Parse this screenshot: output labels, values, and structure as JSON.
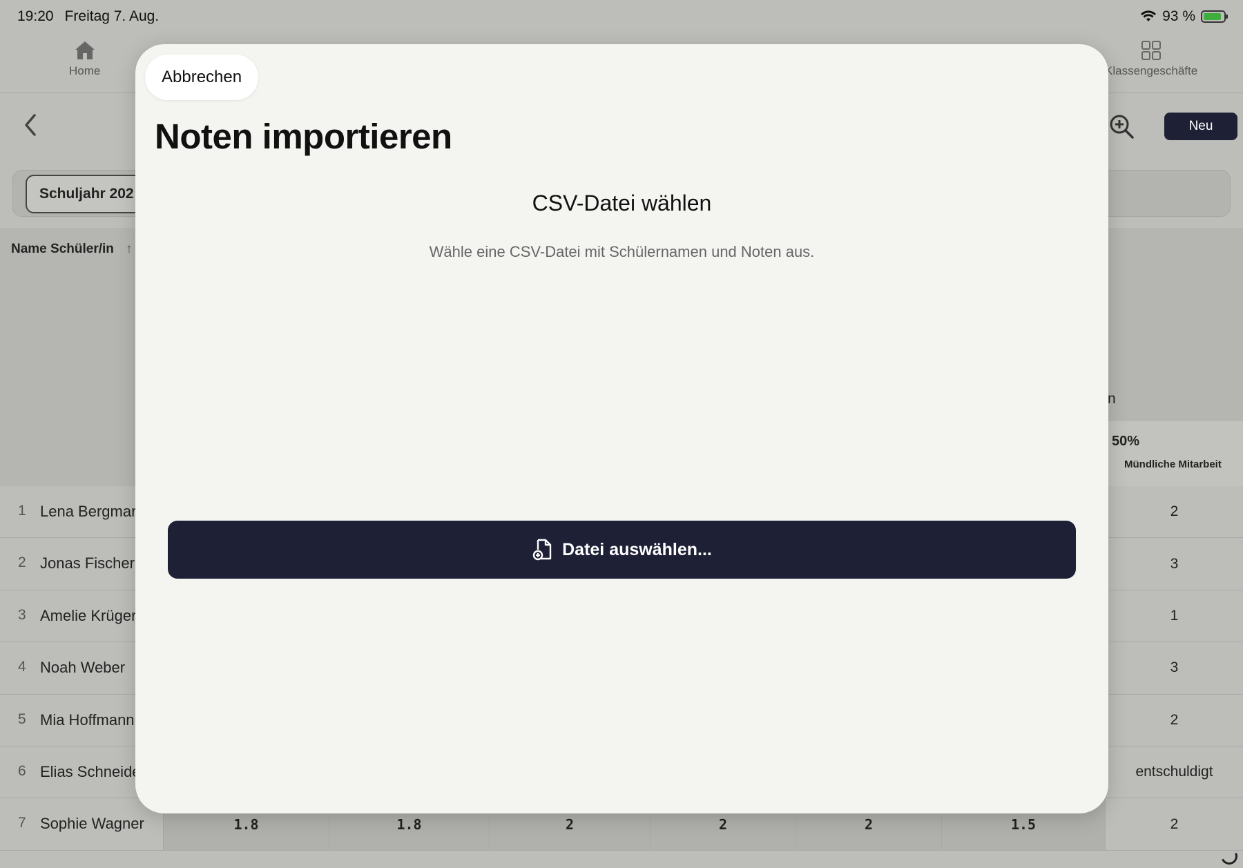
{
  "status": {
    "time": "19:20",
    "date": "Freitag 7. Aug.",
    "battery": "93 %"
  },
  "tabs": {
    "home": "Home",
    "class_business": "Klassengeschäfte"
  },
  "nav": {
    "new_label": "Neu"
  },
  "filter": {
    "school_year": "Schuljahr 202"
  },
  "table": {
    "name_header": "Name Schüler/in",
    "sort_glyph": "↑",
    "partial_header": "n",
    "last_col_percent": "50%",
    "last_col_label": "Mündliche Mitarbeit",
    "rows": [
      {
        "num": "1",
        "name": "Lena Bergmar",
        "last": "2"
      },
      {
        "num": "2",
        "name": "Jonas Fischer",
        "last": "3"
      },
      {
        "num": "3",
        "name": "Amelie Krüger",
        "last": "1"
      },
      {
        "num": "4",
        "name": "Noah Weber",
        "last": "3"
      },
      {
        "num": "5",
        "name": "Mia Hoffmann",
        "last": "2"
      },
      {
        "num": "6",
        "name": "Elias Schneide",
        "last": "entschuldigt"
      },
      {
        "num": "7",
        "name": "Sophie Wagner",
        "last": "2",
        "cells": [
          "1.8",
          "1.8",
          "2",
          "2",
          "2",
          "1.5"
        ]
      }
    ]
  },
  "modal": {
    "cancel_label": "Abbrechen",
    "title": "Noten importieren",
    "subtitle": "CSV-Datei wählen",
    "hint": "Wähle eine CSV-Datei mit Schülernamen und Noten aus.",
    "choose_label": "Datei auswählen..."
  }
}
